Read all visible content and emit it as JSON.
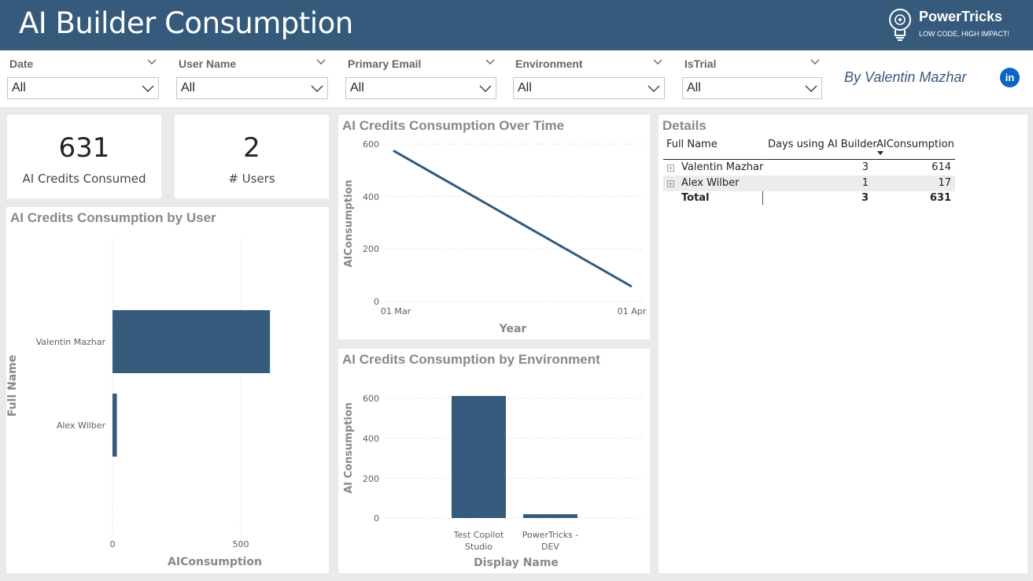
{
  "header": {
    "title": "AI Builder Consumption",
    "logo_name": "PowerTricks",
    "logo_tagline": "LOW CODE, HIGH IMPACT!"
  },
  "filters": [
    {
      "title": "Date",
      "value": "All"
    },
    {
      "title": "User Name",
      "value": "All"
    },
    {
      "title": "Primary Email",
      "value": "All"
    },
    {
      "title": "Environment",
      "value": "All"
    },
    {
      "title": "IsTrial",
      "value": "All"
    }
  ],
  "author": "By Valentin Mazhar",
  "social_icon": "linkedin-icon",
  "kpis": {
    "credits": {
      "value": "631",
      "label": "AI Credits Consumed"
    },
    "users": {
      "value": "2",
      "label": "# Users"
    }
  },
  "colors": {
    "header": "#355a7c",
    "bar": "#355a7c",
    "accent_link": "#0a66c2"
  },
  "by_user": {
    "title": "AI Credits Consumption by User",
    "ylabel": "Full Name",
    "xlabel": "AIConsumption",
    "ticks": [
      "0",
      "500"
    ]
  },
  "over_time": {
    "title": "AI Credits Consumption Over Time",
    "ylabel": "AIConsumption",
    "xlabel": "Year",
    "yticks": [
      "600",
      "400",
      "200",
      "0"
    ],
    "xticks": [
      "01 Mar",
      "01 Apr"
    ]
  },
  "by_env": {
    "title": "AI Credits Consumption by Environment",
    "ylabel": "AI Consumption",
    "xlabel": "Display Name",
    "yticks": [
      "600",
      "400",
      "200",
      "0"
    ]
  },
  "details": {
    "title": "Details",
    "columns": [
      "Full Name",
      "Days using AI Builder",
      "AIConsumption"
    ],
    "rows": [
      {
        "name": "Valentin Mazhar",
        "days": "3",
        "consumption": "614"
      },
      {
        "name": "Alex Wilber",
        "days": "1",
        "consumption": "17"
      }
    ],
    "total": {
      "name": "Total",
      "days": "3",
      "consumption": "631"
    }
  },
  "chart_data": [
    {
      "type": "bar",
      "orientation": "horizontal",
      "title": "AI Credits Consumption by User",
      "categories": [
        "Valentin Mazhar",
        "Alex Wilber"
      ],
      "values": [
        614,
        17
      ],
      "xlabel": "AIConsumption",
      "ylabel": "Full Name",
      "xlim": [
        0,
        614
      ],
      "grid": true
    },
    {
      "type": "line",
      "title": "AI Credits Consumption Over Time",
      "x": [
        "01 Mar",
        "01 Apr"
      ],
      "values": [
        575,
        57
      ],
      "xlabel": "Year",
      "ylabel": "AIConsumption",
      "ylim": [
        0,
        600
      ],
      "grid": true
    },
    {
      "type": "bar",
      "title": "AI Credits Consumption by Environment",
      "categories": [
        "Test Copilot Studio",
        "PowerTricks - DEV"
      ],
      "category_lines": [
        [
          "Test Copilot",
          "Studio"
        ],
        [
          "PowerTricks -",
          "DEV"
        ]
      ],
      "values": [
        612,
        19
      ],
      "xlabel": "Display Name",
      "ylabel": "AI Consumption",
      "ylim": [
        0,
        600
      ],
      "grid": true
    }
  ]
}
